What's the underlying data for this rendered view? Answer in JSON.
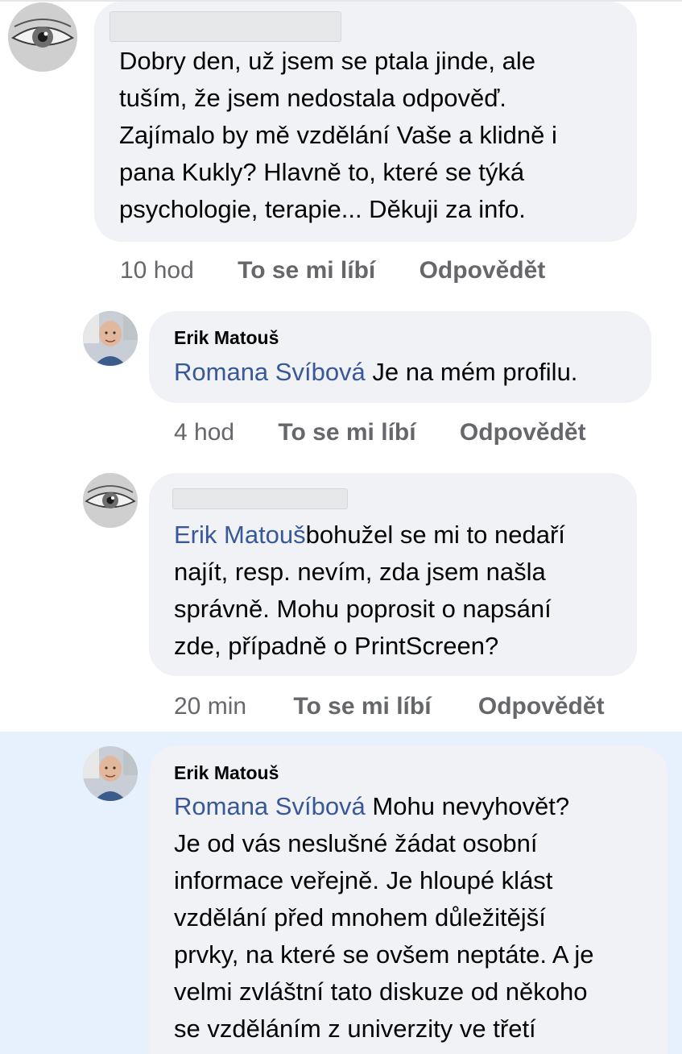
{
  "comments": [
    {
      "author": "",
      "text": "Dobry den, už jsem se ptala jinde, ale tuším, že jsem nedostala odpověď. Zajímalo by mě vzdělání Vaše a klidně i pana Kukly? Hlavně to, které se týká psychologie, terapie... Děkuji za info.",
      "lines": [
        "Dobry den, už jsem se ptala jinde, ale",
        "tuším, že jsem nedostala odpověď.",
        "Zajímalo by mě vzdělání Vaše a klidně i",
        "pana Kukly? Hlavně to, které se týká",
        "psychologie, terapie... Děkuji za info."
      ],
      "time": "10 hod",
      "like_label": "To se mi líbí",
      "reply_label": "Odpovědět"
    },
    {
      "author": "Erik Matouš",
      "mention": "Romana Svíbová",
      "lines_rest": [
        " Je na mém profilu."
      ],
      "time": "4 hod",
      "like_label": "To se mi líbí",
      "reply_label": "Odpovědět"
    },
    {
      "author": "",
      "mention": "Erik Matouš",
      "lines_rest": [
        "bohužel se mi to nedaří",
        "najít, resp. nevím, zda jsem našla",
        "správně. Mohu poprosit o napsání",
        "zde, případně o PrintScreen?"
      ],
      "time": "20 min",
      "like_label": "To se mi líbí",
      "reply_label": "Odpovědět"
    },
    {
      "author": "Erik Matouš",
      "mention": "Romana Svíbová",
      "lines_rest": [
        " Mohu nevyhovět?",
        "Je od vás neslušné žádat osobní",
        "informace veřejně. Je hloupé klást",
        "vzdělání před mnohem důležitější",
        "prvky, na které se ovšem neptáte. A je",
        "velmi zvláštní tato diskuze od někoho",
        "se vzděláním z univerzity ve třetí"
      ]
    }
  ],
  "colors": {
    "mention": "#385898",
    "bubble": "#f0f2f5",
    "meta": "#65676b",
    "highlight": "#e7f0fd"
  },
  "icons": {
    "eye_avatar": "eye-avatar-icon",
    "man_avatar": "man-avatar-icon"
  }
}
